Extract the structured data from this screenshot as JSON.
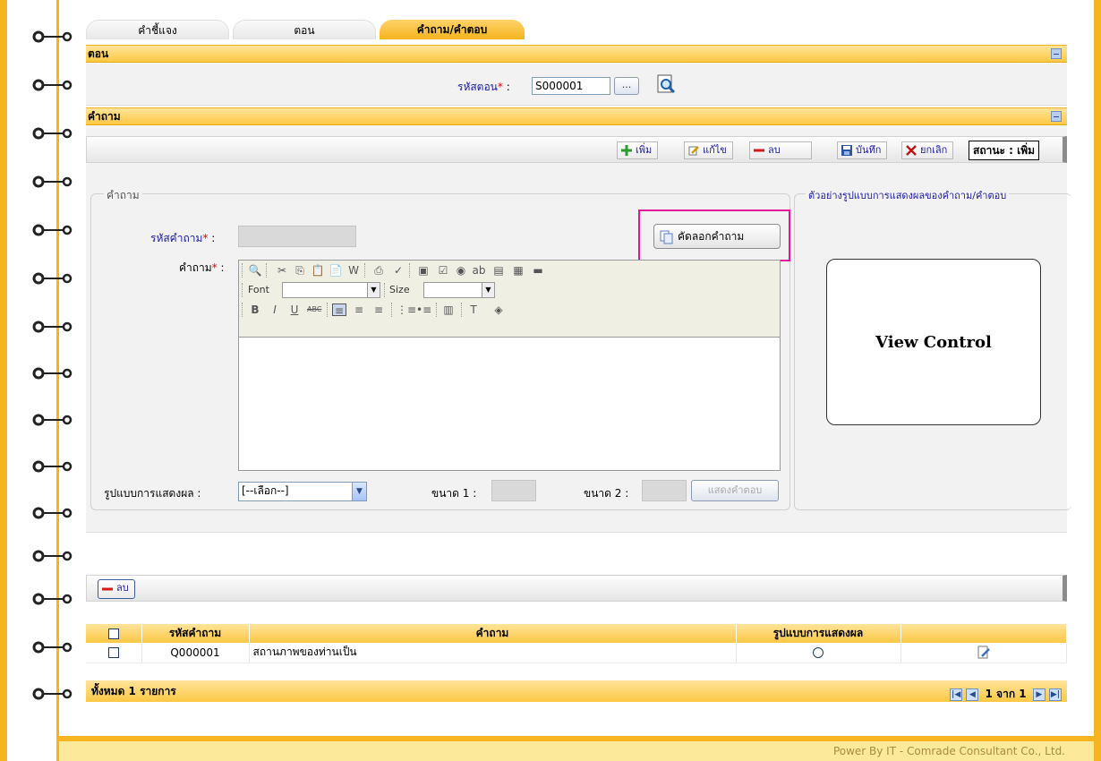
{
  "tabs": [
    {
      "label": "คำชี้แจง",
      "active": false
    },
    {
      "label": "ตอน",
      "active": false
    },
    {
      "label": "คำถาม/คำตอบ",
      "active": true
    }
  ],
  "section_part": {
    "title": "ตอน",
    "code_label": "รหัสตอน",
    "required_mark": "*",
    "colon": ":",
    "code_value": "S000001",
    "browse_label": "..."
  },
  "section_question": {
    "title": "คำถาม",
    "toolbar": {
      "add_label": "เพิ่ม",
      "edit_label": "แก้ไข",
      "delete_label": "ลบ",
      "save_label": "บันทึก",
      "cancel_label": "ยกเลิก",
      "status_text": "สถานะ : เพิ่ม"
    },
    "fieldset_legend": "คำถาม",
    "question_code_label": "รหัสคำถาม",
    "question_label": "คำถาม",
    "copy_button_label": "คัดลอกคำถาม",
    "editor": {
      "font_label": "Font",
      "size_label": "Size"
    },
    "display_format_label": "รูปแบบการแสดงผล :",
    "display_format_value": "[--เลือก--]",
    "size1_label": "ขนาด 1 :",
    "size2_label": "ขนาด 2 :",
    "show_answer_label": "แสดงคำตอบ",
    "preview_legend": "ตัวอย่างรูปแบบการแสดงผลของคำถาม/คำตอบ",
    "preview_text": "View Control"
  },
  "list_toolbar": {
    "delete_label": "ลบ"
  },
  "grid": {
    "headers": [
      "",
      "รหัสคำถาม",
      "คำถาม",
      "รูปแบบการแสดงผล",
      ""
    ],
    "rows": [
      {
        "code": "Q000001",
        "question": "สถานภาพของท่านเป็น",
        "format_icon": "radio-icon",
        "action_icon": "edit-icon"
      }
    ],
    "total_text": "ทั้งหมด 1 รายการ",
    "pager_text": "1 จาก 1"
  },
  "footer_text": "Power By IT - Comrade Consultant Co., Ltd.",
  "colors": {
    "accent": "#f5b420",
    "label_blue": "#1a1aa8",
    "highlight": "#e0159b"
  }
}
